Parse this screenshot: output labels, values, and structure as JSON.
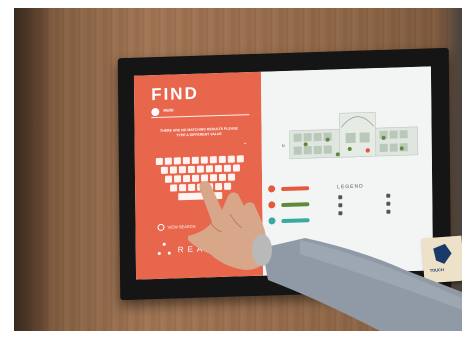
{
  "kiosk": {
    "title": "FIND",
    "search_query": "MUNI",
    "no_results_message": "THERE ARE NO MATCHING RESULTS PLEASE TYPE A DIFFERENT VALUE",
    "view_search_label": "VIEW SEARCH",
    "logo_text": "REA",
    "legend_title": "LEGEND"
  },
  "sticker": {
    "text": "TOUCH"
  },
  "colors": {
    "panel_orange": "#e8674c",
    "map_bg": "#f3f4f4",
    "wood": "#9a6f4f",
    "route_red": "#e55a3c",
    "route_green": "#5f8a3a",
    "route_teal": "#3aa9a0"
  }
}
